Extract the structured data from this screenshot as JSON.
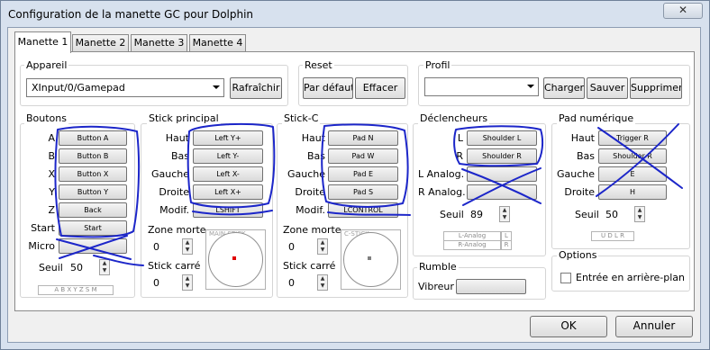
{
  "window": {
    "title": "Configuration de la manette GC pour Dolphin",
    "close_glyph": "✕"
  },
  "tabs": [
    "Manette 1",
    "Manette 2",
    "Manette 3",
    "Manette 4"
  ],
  "device": {
    "label": "Appareil",
    "value": "XInput/0/Gamepad",
    "refresh": "Rafraîchir"
  },
  "reset": {
    "label": "Reset",
    "default": "Par défaut",
    "clear": "Effacer"
  },
  "profile": {
    "label": "Profil",
    "value": "",
    "load": "Charger",
    "save": "Sauver",
    "delete": "Supprimer"
  },
  "buttons": {
    "label": "Boutons",
    "rows": [
      {
        "name": "A",
        "value": "Button A"
      },
      {
        "name": "B",
        "value": "Button B"
      },
      {
        "name": "X",
        "value": "Button X"
      },
      {
        "name": "Y",
        "value": "Button Y"
      },
      {
        "name": "Z",
        "value": "Back"
      },
      {
        "name": "Start",
        "value": "Start"
      },
      {
        "name": "Micro",
        "value": ""
      }
    ],
    "threshold_label": "Seuil",
    "threshold": "50",
    "indicator": "A B X Y Z S M"
  },
  "main_stick": {
    "label": "Stick principal",
    "rows": [
      {
        "name": "Haut",
        "value": "Left Y+"
      },
      {
        "name": "Bas",
        "value": "Left Y-"
      },
      {
        "name": "Gauche",
        "value": "Left X-"
      },
      {
        "name": "Droite",
        "value": "Left X+"
      },
      {
        "name": "Modif.",
        "value": "LSHIFT"
      }
    ],
    "deadzone_label": "Zone morte",
    "deadzone": "0",
    "square_label": "Stick carré",
    "square": "0",
    "preview_label": "MAIN STICK",
    "dot_color": "#e00000"
  },
  "c_stick": {
    "label": "Stick-C",
    "rows": [
      {
        "name": "Haut",
        "value": "Pad N"
      },
      {
        "name": "Bas",
        "value": "Pad W"
      },
      {
        "name": "Gauche",
        "value": "Pad E"
      },
      {
        "name": "Droite",
        "value": "Pad S"
      },
      {
        "name": "Modif.",
        "value": "LCONTROL"
      }
    ],
    "deadzone_label": "Zone morte",
    "deadzone": "0",
    "square_label": "Stick carré",
    "square": "0",
    "preview_label": "C-STICK",
    "dot_color": "#808080"
  },
  "triggers": {
    "label": "Déclencheurs",
    "rows": [
      {
        "name": "L",
        "value": "Shoulder L"
      },
      {
        "name": "R",
        "value": "Shoulder R"
      },
      {
        "name": "L Analog.",
        "value": ""
      },
      {
        "name": "R Analog.",
        "value": ""
      }
    ],
    "threshold_label": "Seuil",
    "threshold": "89",
    "indicator_l": "L-Analog",
    "indicator_r": "R-Analog",
    "l": "L",
    "r": "R"
  },
  "dpad": {
    "label": "Pad numérique",
    "rows": [
      {
        "name": "Haut",
        "value": "Trigger R"
      },
      {
        "name": "Bas",
        "value": "Shoulder R"
      },
      {
        "name": "Gauche",
        "value": "E"
      },
      {
        "name": "Droite",
        "value": "H"
      }
    ],
    "threshold_label": "Seuil",
    "threshold": "50",
    "indicator": "U D L R"
  },
  "rumble": {
    "label": "Rumble",
    "vibrator_label": "Vibreur",
    "value": ""
  },
  "options": {
    "label": "Options",
    "background_input": "Entrée en arrière-plan"
  },
  "dialog": {
    "ok": "OK",
    "cancel": "Annuler"
  },
  "colors": {
    "ink": "#1c26c9",
    "panel": "#ffffff",
    "frame": "#d7e1ee"
  }
}
